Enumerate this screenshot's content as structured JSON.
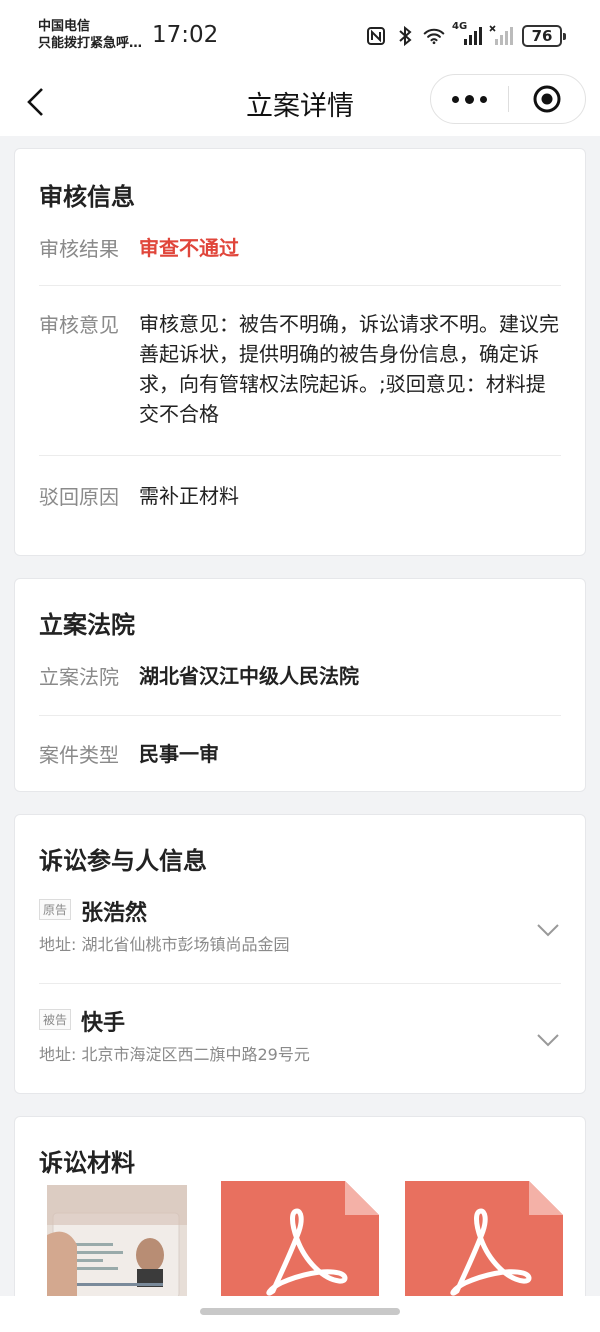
{
  "status_bar": {
    "carrier_line1": "中国电信",
    "carrier_line2": "只能拨打紧急呼…",
    "time": "17:02",
    "network": "4G",
    "battery": "76",
    "icons": [
      "nfc-icon",
      "bluetooth-icon",
      "wifi-icon",
      "signal-icon",
      "signal-off-icon",
      "battery-icon"
    ]
  },
  "nav": {
    "title": "立案详情",
    "back_icon": "chevron-left-icon",
    "more_icon": "more-dots-icon",
    "home_icon": "target-icon"
  },
  "review": {
    "title": "审核信息",
    "result_label": "审核结果",
    "result_value": "审查不通过",
    "opinion_label": "审核意见",
    "opinion_value": "审核意见：被告不明确，诉讼请求不明。建议完善起诉状，提供明确的被告身份信息，确定诉求，向有管辖权法院起诉。;驳回意见：材料提交不合格",
    "reason_label": "驳回原因",
    "reason_value": "需补正材料",
    "colors": {
      "result": "#e0463b"
    }
  },
  "court": {
    "title": "立案法院",
    "court_label": "立案法院",
    "court_value": "湖北省汉江中级人民法院",
    "type_label": "案件类型",
    "type_value": "民事一审"
  },
  "parties": {
    "title": "诉讼参与人信息",
    "items": [
      {
        "tag": "原告",
        "name": "张浩然",
        "address": "地址: 湖北省仙桃市彭场镇尚品金园"
      },
      {
        "tag": "被告",
        "name": "快手",
        "address": "地址: 北京市海淀区西二旗中路29号元"
      }
    ]
  },
  "materials": {
    "title": "诉讼材料",
    "files": [
      {
        "kind": "id-card-photo"
      },
      {
        "kind": "pdf",
        "color": "#e8705f"
      },
      {
        "kind": "pdf",
        "color": "#e8705f"
      }
    ]
  }
}
